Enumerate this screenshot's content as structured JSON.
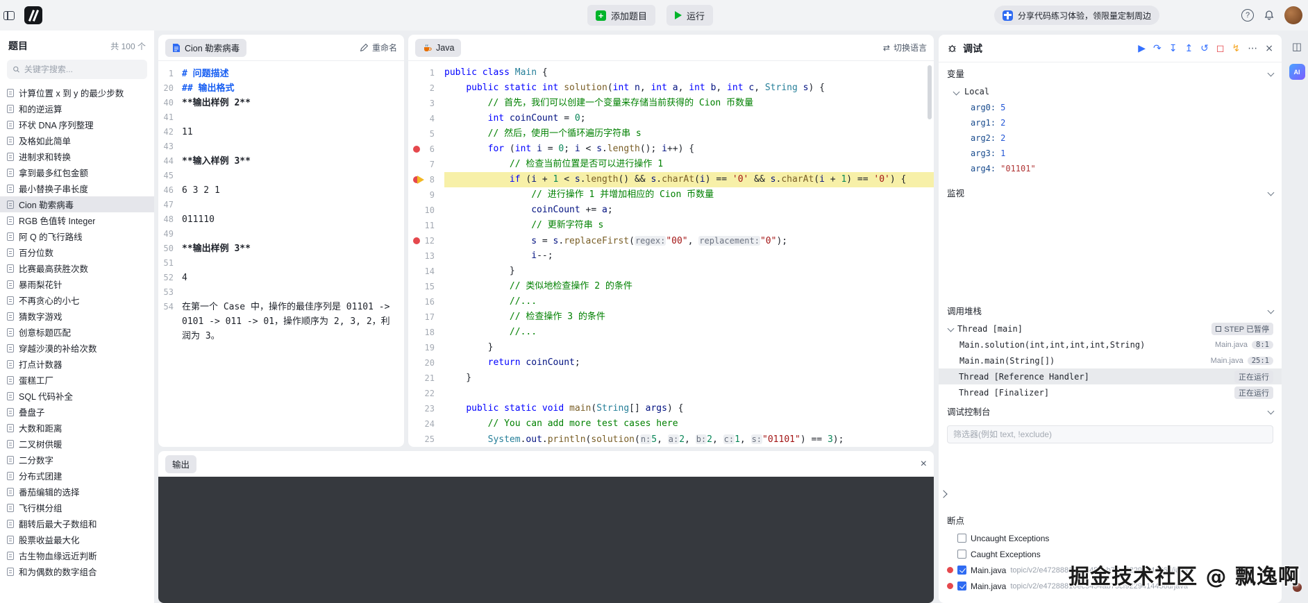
{
  "topbar": {
    "add_label": "添加题目",
    "run_label": "运行",
    "promo": "分享代码练习体验，领限量定制周边"
  },
  "sidebar": {
    "title": "题目",
    "count": "共 100 个",
    "search_placeholder": "关键字搜索...",
    "selected_index": 7,
    "items": [
      "计算位置 x 到 y 的最少步数",
      "和的逆运算",
      "环状 DNA 序列整理",
      "及格如此简单",
      "进制求和转换",
      "拿到最多红包金额",
      "最小替换子串长度",
      "Cion 勒索病毒",
      "RGB 色值转 Integer",
      "阿 Q 的飞行路线",
      "百分位数",
      "比赛最高获胜次数",
      "暴雨梨花针",
      "不再贪心的小七",
      "猜数字游戏",
      "创意标题匹配",
      "穿越沙漠的补给次数",
      "打点计数器",
      "蛋糕工厂",
      "SQL 代码补全",
      "叠盘子",
      "大数和距离",
      "二叉树供暖",
      "二分数字",
      "分布式团建",
      "番茄编辑的选择",
      "飞行棋分组",
      "翻转后最大子数组和",
      "股票收益最大化",
      "古生物血缘远近判断",
      "和为偶数的数字组合"
    ]
  },
  "problem": {
    "tab_label": "Cion 勒索病毒",
    "rename_label": "重命名",
    "lines": [
      {
        "no": "1",
        "text": "# 问题描述",
        "cls": "md-h"
      },
      {
        "no": "20",
        "text": "## 输出格式",
        "cls": "md-h"
      },
      {
        "no": "40",
        "text": "**输出样例 2**",
        "cls": "md-b"
      },
      {
        "no": "41",
        "text": ""
      },
      {
        "no": "42",
        "text": "11"
      },
      {
        "no": "43",
        "text": ""
      },
      {
        "no": "44",
        "text": "**输入样例 3**",
        "cls": "md-b"
      },
      {
        "no": "45",
        "text": ""
      },
      {
        "no": "46",
        "text": "6 3 2 1"
      },
      {
        "no": "47",
        "text": ""
      },
      {
        "no": "48",
        "text": "011110"
      },
      {
        "no": "49",
        "text": ""
      },
      {
        "no": "50",
        "text": "**输出样例 3**",
        "cls": "md-b"
      },
      {
        "no": "51",
        "text": ""
      },
      {
        "no": "52",
        "text": "4"
      },
      {
        "no": "53",
        "text": ""
      },
      {
        "no": "54",
        "text": "在第一个 Case 中，操作的最佳序列是 01101 -> 0101 -> 011 -> 01，操作顺序为 2, 3, 2，利润为 3。"
      }
    ]
  },
  "editor": {
    "tab_label": "Java",
    "switch_label": "切换语言",
    "current_line": 8,
    "breakpoints": [
      6,
      12
    ],
    "code": [
      "public class Main {",
      "    public static int solution(int n, int a, int b, int c, String s) {",
      "        // 首先，我们可以创建一个变量来存储当前获得的 Cion 币数量",
      "        int coinCount = 0;",
      "        // 然后，使用一个循环遍历字符串 s",
      "        for (int i = 0; i < s.length(); i++) {",
      "            // 检查当前位置是否可以进行操作 1",
      "            if (i + 1 < s.length() && s.charAt(i) == '0' && s.charAt(i + 1) == '0') {",
      "                // 进行操作 1 并增加相应的 Cion 币数量",
      "                coinCount += a;",
      "                // 更新字符串 s",
      "                s = s.replaceFirst(regex:\"00\", replacement:\"0\");",
      "                i--;",
      "            }",
      "            // 类似地检查操作 2 的条件",
      "            //...",
      "            // 检查操作 3 的条件",
      "            //...",
      "        }",
      "        return coinCount;",
      "    }",
      "",
      "    public static void main(String[] args) {",
      "        // You can add more test cases here",
      "        System.out.println(solution(n:5, a:2, b:2, c:1, s:\"01101\") == 3);"
    ]
  },
  "output": {
    "title": "输出"
  },
  "debug": {
    "title": "调试",
    "toolbar": [
      {
        "name": "continue-icon",
        "glyph": "▶",
        "cls": "blue"
      },
      {
        "name": "step-over-icon",
        "glyph": "↷",
        "cls": "blue"
      },
      {
        "name": "step-into-icon",
        "glyph": "↧",
        "cls": "blue"
      },
      {
        "name": "step-out-icon",
        "glyph": "↥",
        "cls": "blue"
      },
      {
        "name": "restart-icon",
        "glyph": "↺",
        "cls": "blue"
      },
      {
        "name": "stop-icon",
        "glyph": "◻",
        "cls": "red"
      },
      {
        "name": "hot-reload-icon",
        "glyph": "↯",
        "cls": "yellow"
      },
      {
        "name": "more-icon",
        "glyph": "⋯",
        "cls": "gray"
      },
      {
        "name": "close-icon",
        "glyph": "×",
        "cls": "gray"
      }
    ],
    "sections": {
      "variables": "变量",
      "watch": "监视",
      "callstack": "调用堆栈",
      "console": "调试控制台",
      "breakpoints": "断点"
    },
    "scope_label": "Local",
    "variables": [
      {
        "name": "arg0",
        "value": "5",
        "kind": "num"
      },
      {
        "name": "arg1",
        "value": "2",
        "kind": "num"
      },
      {
        "name": "arg2",
        "value": "2",
        "kind": "num"
      },
      {
        "name": "arg3",
        "value": "1",
        "kind": "num"
      },
      {
        "name": "arg4",
        "value": "\"01101\"",
        "kind": "str"
      }
    ],
    "callstack": [
      {
        "type": "thread-open",
        "label": "Thread [main]",
        "badge": "STEP 已暂停"
      },
      {
        "type": "frame",
        "label": "Main.solution(int,int,int,int,String)",
        "file": "Main.java",
        "line": "8:1"
      },
      {
        "type": "frame",
        "label": "Main.main(String[])",
        "file": "Main.java",
        "line": "25:1"
      },
      {
        "type": "thread",
        "label": "Thread [Reference Handler]",
        "badge": "正在运行",
        "selected": true
      },
      {
        "type": "thread",
        "label": "Thread [Finalizer]",
        "badge": "正在运行"
      }
    ],
    "console_placeholder": "筛选器(例如 text, !exclude)",
    "breakpoints_list": [
      {
        "label": "Uncaught Exceptions",
        "checked": false,
        "dot": false,
        "path": ""
      },
      {
        "label": "Caught Exceptions",
        "checked": false,
        "dot": false,
        "path": ""
      },
      {
        "label": "Main.java",
        "checked": true,
        "dot": true,
        "path": "topic/v2/e47288810ec5454ab75cf9229414456d/java"
      },
      {
        "label": "Main.java",
        "checked": true,
        "dot": true,
        "path": "topic/v2/e47288810ec5454ab75cf9229414456d/java"
      }
    ]
  },
  "strip": {
    "ai_label": "AI"
  },
  "watermark": "掘金技术社区 @ 飘逸啊"
}
